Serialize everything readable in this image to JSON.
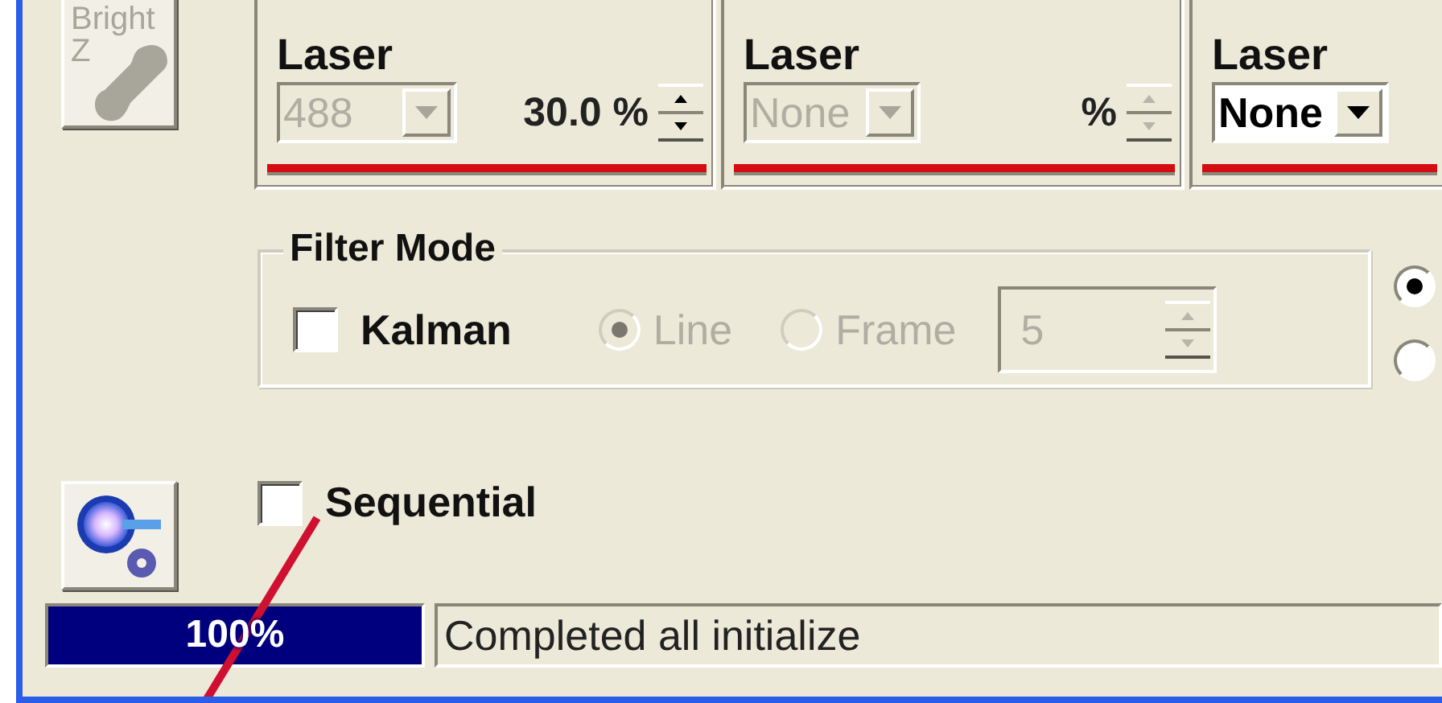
{
  "bright_z_button": {
    "label": "Bright",
    "sublabel": "Z",
    "disabled": true
  },
  "channels": [
    {
      "label": "Laser",
      "value": "488",
      "disabled": true,
      "power": "30.0 %"
    },
    {
      "label": "Laser",
      "value": "None",
      "disabled": true,
      "power": "%"
    },
    {
      "label": "Laser",
      "value": "None",
      "disabled": false
    }
  ],
  "filter_mode": {
    "title": "Filter Mode",
    "disabled": true,
    "kalman": {
      "label": "Kalman",
      "checked": false
    },
    "modes": [
      {
        "label": "Line",
        "selected": true
      },
      {
        "label": "Frame",
        "selected": false
      }
    ],
    "frames": "5"
  },
  "side_radios": [
    {
      "selected": true
    },
    {
      "selected": false
    }
  ],
  "sequential": {
    "label": "Sequential",
    "checked": false
  },
  "progress": {
    "level": 1,
    "text": "100%"
  },
  "status": "Completed all initialize"
}
